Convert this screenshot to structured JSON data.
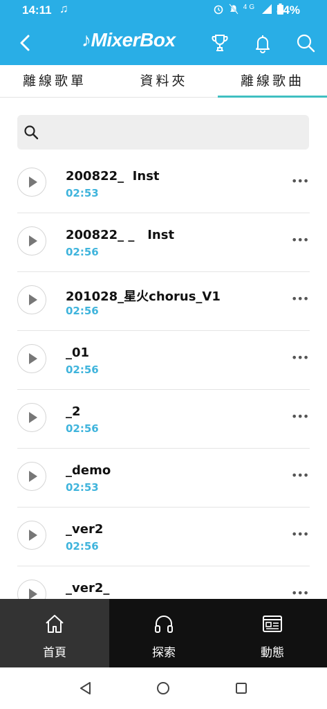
{
  "status_bar": {
    "time": "14:11",
    "network": "4G",
    "battery": "84%"
  },
  "app_bar": {
    "logo": "MixerBox"
  },
  "tabs": [
    {
      "label": "離線歌單"
    },
    {
      "label": "資料夾"
    },
    {
      "label": "離線歌曲"
    }
  ],
  "search": {
    "placeholder": ""
  },
  "songs": [
    {
      "title": "200822_  Inst",
      "duration": "02:53"
    },
    {
      "title": "200822_ _   Inst",
      "duration": "02:56"
    },
    {
      "title": "201028_星火chorus_V1",
      "duration": "02:56"
    },
    {
      "title": "_01",
      "duration": "02:56"
    },
    {
      "title": "_2",
      "duration": "02:56"
    },
    {
      "title": "_demo",
      "duration": "02:53"
    },
    {
      "title": "_ver2",
      "duration": "02:56"
    },
    {
      "title": "_ver2_",
      "duration": ""
    }
  ],
  "more_glyph": "•••",
  "bottom_nav": [
    {
      "label": "首頁"
    },
    {
      "label": "探索"
    },
    {
      "label": "動態"
    }
  ],
  "colors": {
    "app_bar": "#29aee6",
    "accent_teal": "#3fbfc1",
    "duration": "#3fb4dc",
    "bottom_nav": "#111111"
  }
}
